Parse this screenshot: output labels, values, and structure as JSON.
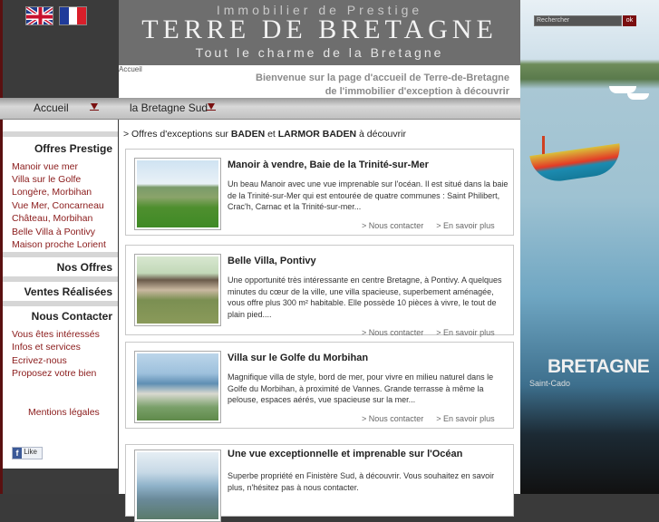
{
  "header": {
    "top": "Immobilier de Prestige",
    "brand": "TERRE DE BRETAGNE",
    "tagline": "Tout le charme de la Bretagne"
  },
  "breadcrumb": "Accueil",
  "welcome": {
    "line1": "Bienvenue sur la page d'accueil de Terre-de-Bretagne",
    "line2": "de l'immobilier d'exception à découvrir"
  },
  "nav": {
    "accueil": "Accueil",
    "bretagne_sud": "la Bretagne Sud"
  },
  "sidebar": {
    "offres_prestige": "Offres Prestige",
    "offres": [
      "Manoir vue mer",
      "Villa sur le Golfe",
      "Longère, Morbihan",
      "Vue Mer, Concarneau",
      "Château, Morbihan",
      "Belle Villa à Pontivy",
      "Maison proche Lorient"
    ],
    "nos_offres": "Nos Offres",
    "ventes": "Ventes Réalisées",
    "contact": "Nous Contacter",
    "contact_links": [
      "Vous êtes intéressés",
      "Infos et services",
      "Ecrivez-nous",
      "Proposez votre bien"
    ],
    "mentions": "Mentions légales",
    "like": "Like"
  },
  "intro": {
    "prefix": "> Offres d'exceptions sur ",
    "place1": "BADEN",
    "mid": " et ",
    "place2": "LARMOR BADEN",
    "suffix": " à découvrir"
  },
  "listings": [
    {
      "title": "Manoir à vendre, Baie de la Trinité-sur-Mer",
      "desc": "Un beau Manoir avec une vue imprenable sur l'océan. Il est situé dans la baie de la Trinité-sur-Mer qui est entourée de quatre communes : Saint Philibert, Crac'h, Carnac et la Trinité-sur-mer...",
      "contact": "> Nous contacter",
      "more": "> En savoir plus"
    },
    {
      "title": "Belle Villa, Pontivy",
      "desc": "Une opportunité très intéressante en centre Bretagne, à Pontivy. A quelques minutes du cœur de la ville, une villa spacieuse, superbement aménagée, vous offre plus 300 m² habitable. Elle possède 10 pièces à vivre, le tout de plain pied....",
      "contact": "> Nous contacter",
      "more": "> En savoir plus"
    },
    {
      "title": "Villa sur le Golfe du Morbihan",
      "desc": "Magnifique villa de style, bord de mer, pour vivre en milieu naturel dans le Golfe du Morbihan, à proximité de Vannes. Grande terrasse à même la pelouse, espaces aérés, vue spacieuse sur la mer...",
      "contact": "> Nous contacter",
      "more": "> En savoir plus"
    },
    {
      "title": "Une vue exceptionnelle et imprenable sur l'Océan",
      "desc": "Superbe propriété en Finistère Sud, à découvrir. Vous souhaitez en savoir plus, n'hésitez pas à nous contacter.",
      "contact": "",
      "more": ""
    }
  ],
  "search": {
    "placeholder": "Rechercher",
    "ok": "ok"
  },
  "photo": {
    "title": "BRETAGNE",
    "subtitle": "Saint-Cado"
  }
}
